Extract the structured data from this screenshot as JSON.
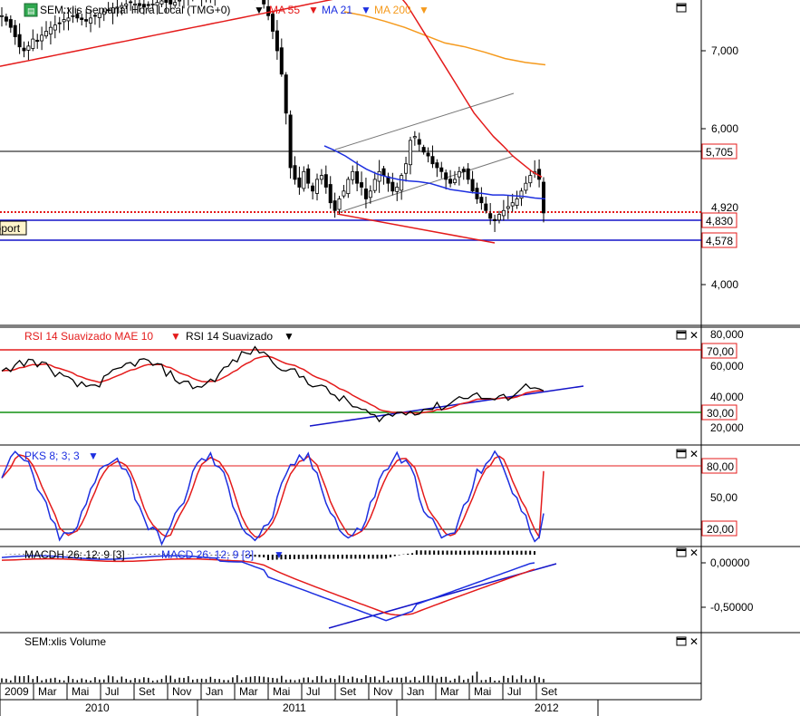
{
  "colors": {
    "price_fg": "#000000",
    "ma55": "#e41b1b",
    "ma21": "#1d2fe0",
    "ma200": "#f59a1d",
    "rsi": "#000000",
    "rsi_mae": "#e41b1b",
    "pks_k": "#1d2fe0",
    "pks_d": "#e41b1b",
    "macd_signal": "#1d2fe0",
    "macd_line": "#e41b1b",
    "support": "#1414c8",
    "resistance_line": "#000000",
    "dotted_red": "#e41b1b",
    "box_label_border": "#e41b1b",
    "rsi_upper": "#e41b1b",
    "rsi_lower": "#129112"
  },
  "icons": {
    "maximize": "maximize-icon",
    "close": "close-icon",
    "dropdown": "triangle-down-icon",
    "ticker_badge": "ticker-badge-icon"
  },
  "header": {
    "ticker_label": "SEM:xlis Semanal Hora Local (TMG+0)",
    "ma55": "MA 55",
    "ma21": "MA 21",
    "ma200": "MA 200"
  },
  "support_label": "Support",
  "panels": {
    "rsi": {
      "title_mae": "RSI 14 Suavizado MAE 10",
      "title": "RSI 14 Suavizado"
    },
    "pks": {
      "title": "PKS 8; 3; 3"
    },
    "macd": {
      "title_a": "MACDH 26; 12; 9 [3]",
      "title_b": "MACD 26; 12; 9 [3]"
    },
    "volume": {
      "title": "SEM:xlis Volume"
    }
  },
  "axis": {
    "price_ticks": [
      "7,000",
      "6,000",
      "4,000"
    ],
    "price_boxes": [
      "5,705",
      "4,830",
      "4,578"
    ],
    "price_hidden_tick": "4,920",
    "rsi_ticks": [
      "80,000",
      "60,000",
      "40,000",
      "20,000"
    ],
    "rsi_boxes": [
      "70,00",
      "30,00"
    ],
    "pks_ticks": [
      "50,00"
    ],
    "pks_boxes": [
      "80,00",
      "20,00"
    ],
    "macd_ticks": [
      "0,00000",
      "-0,50000"
    ]
  },
  "time_axis": {
    "months": [
      "2009",
      "Mar",
      "Mai",
      "Jul",
      "Set",
      "Nov",
      "Jan",
      "Mar",
      "Mai",
      "Jul",
      "Set",
      "Nov",
      "Jan",
      "Mar",
      "Mai",
      "Jul",
      "Set"
    ],
    "years": [
      "2010",
      "2011",
      "2012"
    ]
  },
  "chart_data": {
    "type": "line",
    "timeframe": "weekly",
    "x_range": [
      "2009-12",
      "2012-09"
    ],
    "price": {
      "ylim": [
        3600,
        7600
      ],
      "close": [
        7450,
        7380,
        7300,
        7180,
        7050,
        7000,
        7060,
        7150,
        7120,
        7200,
        7250,
        7300,
        7330,
        7350,
        7400,
        7420,
        7450,
        7420,
        7400,
        7380,
        7420,
        7450,
        7480,
        7500,
        7520,
        7550,
        7560,
        7580,
        7600,
        7620,
        7600,
        7580,
        7560,
        7580,
        7600,
        7620,
        7640,
        7620,
        7600,
        7620,
        7650,
        7680,
        7700,
        7720,
        7700,
        7680,
        7700,
        7720,
        7740,
        7760,
        7780,
        7800,
        7820,
        7820,
        7800,
        7780,
        7760,
        7760,
        7720,
        7600,
        7450,
        7250,
        7000,
        6700,
        6200,
        5500,
        5350,
        5250,
        5450,
        5300,
        5200,
        5350,
        5400,
        5250,
        5050,
        4950,
        5100,
        5200,
        5350,
        5450,
        5300,
        5250,
        5100,
        5200,
        5350,
        5450,
        5400,
        5300,
        5200,
        5250,
        5400,
        5550,
        5850,
        5900,
        5800,
        5700,
        5650,
        5550,
        5500,
        5450,
        5350,
        5300,
        5350,
        5450,
        5450,
        5350,
        5200,
        5100,
        5050,
        4950,
        4850,
        4820,
        4900,
        4950,
        5000,
        5050,
        5100,
        5200,
        5300,
        5400,
        5450,
        5350,
        4920
      ],
      "ma21_end": [
        5780,
        5720,
        5650,
        5560,
        5480,
        5420,
        5380,
        5350,
        5330,
        5320,
        5300,
        5260,
        5220,
        5200,
        5180,
        5170,
        5150,
        5150,
        5140,
        5130,
        5110,
        5100
      ],
      "ma55_end": [
        7750,
        7600,
        7400,
        7200,
        7000,
        6800,
        6600,
        6400,
        6200,
        6050,
        5900,
        5780,
        5650,
        5550,
        5450,
        5380
      ],
      "ma200": [
        7500,
        7450,
        7380,
        7300,
        7200,
        7100,
        7050,
        6980,
        6900,
        6850,
        6820
      ],
      "levels": {
        "resistance": 5705,
        "support_a": 4830,
        "support_b": 4578,
        "last_close": 4920
      }
    },
    "rsi": {
      "ylim": [
        10,
        90
      ],
      "bands": [
        70,
        30
      ],
      "smoothed_start": 60,
      "trough": 24,
      "peak": 72,
      "last": 44
    },
    "pks": {
      "ylim": [
        0,
        100
      ],
      "bands": [
        80,
        20
      ],
      "last_k": 35,
      "last_d": 75
    },
    "macd": {
      "ylim": [
        -0.75,
        0.15
      ],
      "min": -0.6,
      "last": 0.0
    }
  }
}
